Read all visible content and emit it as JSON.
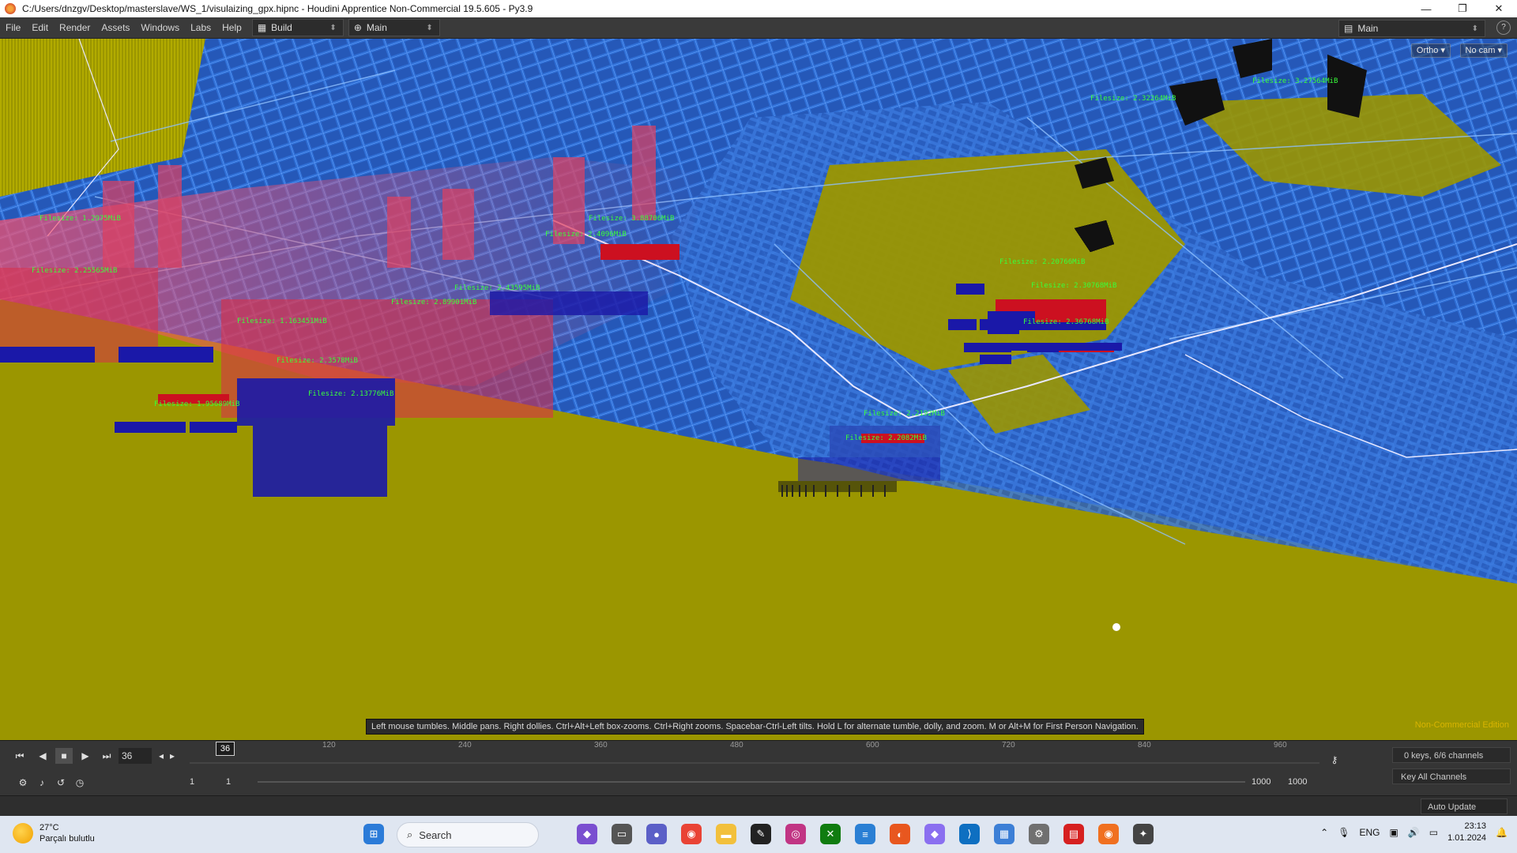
{
  "window": {
    "title": "C:/Users/dnzgv/Desktop/masterslave/WS_1/visulaizing_gpx.hipnc - Houdini Apprentice Non-Commercial 19.5.605 - Py3.9",
    "minimize": "—",
    "maximize": "❐",
    "close": "✕"
  },
  "menu": {
    "items": [
      "File",
      "Edit",
      "Render",
      "Assets",
      "Windows",
      "Labs",
      "Help"
    ],
    "desktop_build": "Build",
    "desktop_main": "Main",
    "right_desktop": "Main"
  },
  "viewport": {
    "ortho_button": "Ortho ▾",
    "cam_button": "No cam ▾",
    "hint": "Left mouse tumbles. Middle pans. Right dollies. Ctrl+Alt+Left box-zooms. Ctrl+Right zooms. Spacebar-Ctrl-Left tilts. Hold L for alternate tumble, dolly, and zoom.     M or Alt+M for First Person Navigation.",
    "noncommercial": "Non-Commercial Edition",
    "file_labels": [
      "Filesize: 1.2975MiB",
      "Filesize: 2.25565MiB",
      "Filesize: 3.88706MiB",
      "Filesize: 2.4096MiB",
      "Filesize: 2.32264MiB",
      "Filesize: 3.27564MiB",
      "Filesize: 2.43595MiB",
      "Filesize: 2.89901MiB",
      "Filesize: 1.163451MiB",
      "Filesize: 2.3578MiB",
      "Filesize: 1.95689MiB",
      "Filesize: 2.13776MiB",
      "Filesize: 2.20766MiB",
      "Filesize: 2.30768MiB",
      "Filesize: 2.36768MiB",
      "Filesize: 2.2192MiB",
      "Filesize: 2.2082MiB"
    ]
  },
  "timeline": {
    "current_frame": "36",
    "playhead": "36",
    "ticks": [
      "120",
      "240",
      "360",
      "480",
      "600",
      "720",
      "840",
      "960"
    ],
    "start": "1",
    "start2": "1",
    "end": "1000",
    "end2": "1000",
    "keys_channels": "0 keys, 6/6 channels",
    "key_all": "Key All Channels"
  },
  "status": {
    "auto_update": "Auto Update"
  },
  "taskbar": {
    "temperature": "27°C",
    "weather": "Parçalı bulutlu",
    "search": "Search",
    "language": "ENG",
    "time": "23:13",
    "date": "1.01.2024"
  },
  "colors": {
    "ground": "#9b9600",
    "streets": "#2f6fd6",
    "tracks": "#d8304a",
    "label_text": "#39ff3b"
  }
}
